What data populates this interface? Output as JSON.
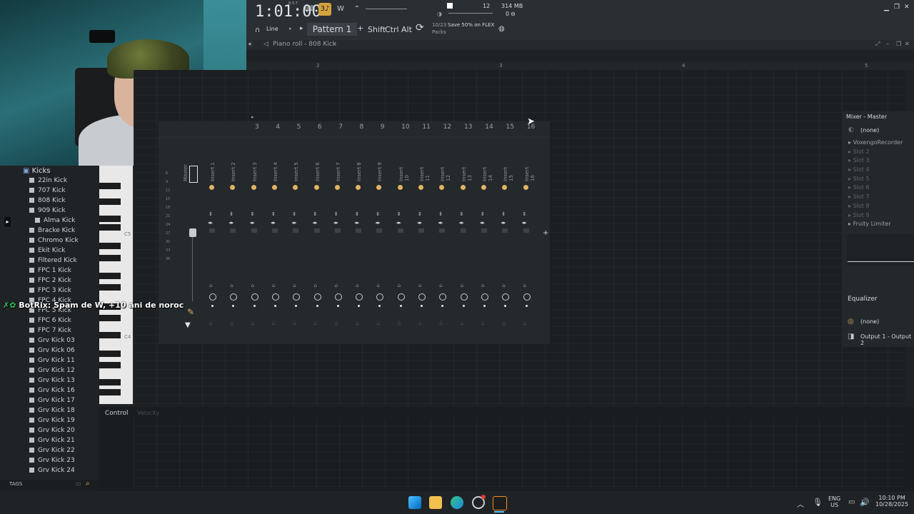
{
  "topbar": {
    "time": "1:01:00",
    "bst": "B:S:T",
    "pattern": "Pattern 1",
    "tool_mode": "Line",
    "modifiers": [
      "Shift",
      "Ctrl",
      "Alt"
    ],
    "cpu": "12",
    "memory": "314 MB",
    "poly": "0",
    "packs_counter": "10/23",
    "packs_label": "Packs",
    "promo": "Save 50% on FLEX"
  },
  "piano_roll": {
    "title": "Piano roll - 808 Kick",
    "timeline_marks": [
      "2",
      "3",
      "4",
      "5"
    ],
    "control_label": "Control",
    "control_target": "Velocity",
    "key_labels": [
      "C5",
      "C4"
    ]
  },
  "browser": {
    "folder": "Kicks",
    "items": [
      "22in Kick",
      "707 Kick",
      "808 Kick",
      "909 Kick",
      "Alma Kick",
      "Bracke Kick",
      "Chromo Kick",
      "Ekit Kick",
      "Filtered Kick",
      "FPC 1 Kick",
      "FPC 2 Kick",
      "FPC 3 Kick",
      "FPC 4 Kick",
      "FPC 5 Kick",
      "FPC 6 Kick",
      "FPC 7 Kick",
      "Grv Kick 03",
      "Grv Kick 06",
      "Grv Kick 11",
      "Grv Kick 12",
      "Grv Kick 13",
      "Grv Kick 16",
      "Grv Kick 17",
      "Grv Kick 18",
      "Grv Kick 19",
      "Grv Kick 20",
      "Grv Kick 21",
      "Grv Kick 22",
      "Grv Kick 23",
      "Grv Kick 24"
    ],
    "tags_label": "TAGS"
  },
  "mixer": {
    "channel_numbers": [
      "3",
      "4",
      "5",
      "6",
      "7",
      "8",
      "9",
      "10",
      "11",
      "12",
      "13",
      "14",
      "15",
      "16"
    ],
    "strips": [
      "Master",
      "Insert 1",
      "Insert 2",
      "Insert 3",
      "Insert 4",
      "Insert 5",
      "Insert 6",
      "Insert 7",
      "Insert 8",
      "Insert 9",
      "Insert 10",
      "Insert 11",
      "Insert 12",
      "Insert 13",
      "Insert 14",
      "Insert 15",
      "Insert 16"
    ],
    "meter_scale": [
      "6",
      "9",
      "12",
      "15",
      "18",
      "21",
      "24",
      "27",
      "30",
      "33",
      "36"
    ]
  },
  "mixer_master": {
    "title": "Mixer - Master",
    "input": "(none)",
    "slots": [
      "VoxengoRecorder",
      "Slot 2",
      "Slot 3",
      "Slot 4",
      "Slot 5",
      "Slot 6",
      "Slot 7",
      "Slot 8",
      "Slot 9",
      "Fruity Limiter"
    ],
    "eq_label": "Equalizer",
    "output_none": "(none)",
    "output": "Output 1 - Output 2"
  },
  "chat": {
    "user": "BotRix:",
    "message": "Spam de W, +10 ani de noroc"
  },
  "taskbar": {
    "lang": "ENG",
    "region": "US",
    "time": "10:10 PM",
    "date": "10/28/2025"
  },
  "colors": {
    "accent": "#e0b560",
    "background": "#1d2124",
    "panel": "#24292c"
  }
}
